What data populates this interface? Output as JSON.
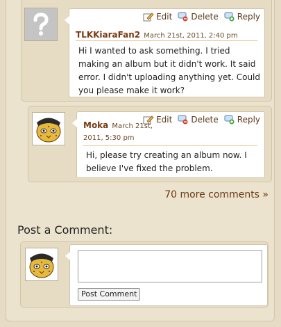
{
  "comments": [
    {
      "user": "TLKKiaraFan2",
      "date": "March 21st, 2011, 2:40 pm",
      "text": "Hi I wanted to ask something. I tried making an album but it didn't work. It said error. I didn't uploading anything yet. Could you please make it work?",
      "avatar": "question-mark-avatar"
    },
    {
      "user": "Moka",
      "date_line1": "March 21st,",
      "date_line2": "2011, 5:30 pm",
      "text": "Hi, please try creating an album now. I believe I've fixed the problem.",
      "avatar": "cheetah-avatar"
    }
  ],
  "actions": {
    "edit": "Edit",
    "delete": "Delete",
    "reply": "Reply"
  },
  "more_comments": "70 more comments »",
  "post": {
    "title": "Post a Comment:",
    "textarea_value": "",
    "button": "Post Comment"
  },
  "colors": {
    "link": "#7a3a10",
    "panel": "#e6dcc4",
    "page": "#e6dcc6"
  },
  "icons": [
    "edit-icon",
    "delete-icon",
    "reply-icon"
  ]
}
